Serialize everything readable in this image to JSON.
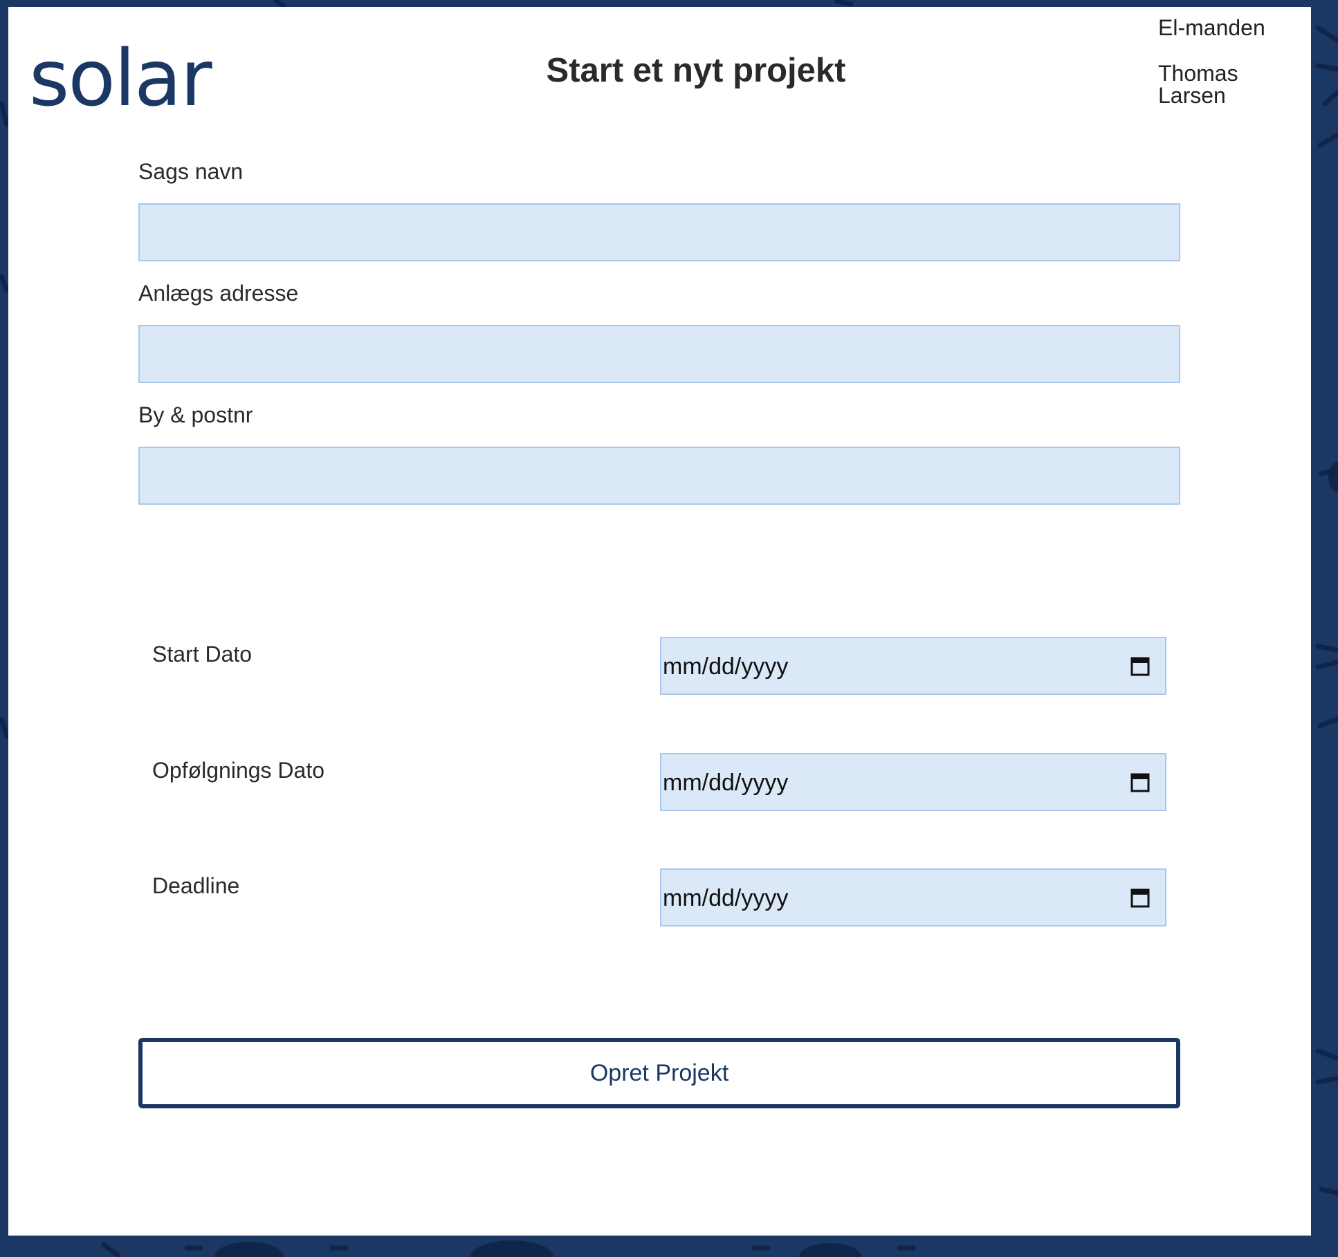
{
  "brand": {
    "logo_text": "solar",
    "color": "#1b3764"
  },
  "header": {
    "title": "Start et nyt projekt"
  },
  "user": {
    "company": "El-manden",
    "name": "Thomas Larsen"
  },
  "form": {
    "case_name": {
      "label": "Sags navn",
      "value": ""
    },
    "site_address": {
      "label": "Anlægs adresse",
      "value": ""
    },
    "city_zip": {
      "label": "By & postnr",
      "value": ""
    },
    "start_date": {
      "label": "Start Dato",
      "placeholder": "mm/dd/yyyy",
      "icon": "calendar-icon"
    },
    "followup_date": {
      "label": "Opfølgnings Dato",
      "placeholder": "mm/dd/yyyy",
      "icon": "calendar-icon"
    },
    "deadline": {
      "label": "Deadline",
      "placeholder": "mm/dd/yyyy",
      "icon": "calendar-icon"
    },
    "submit_label": "Opret Projekt"
  },
  "colors": {
    "background": "#1b3764",
    "input_fill": "#dbe8f7",
    "input_border": "#a9c8ec",
    "button_border": "#1b3764"
  }
}
